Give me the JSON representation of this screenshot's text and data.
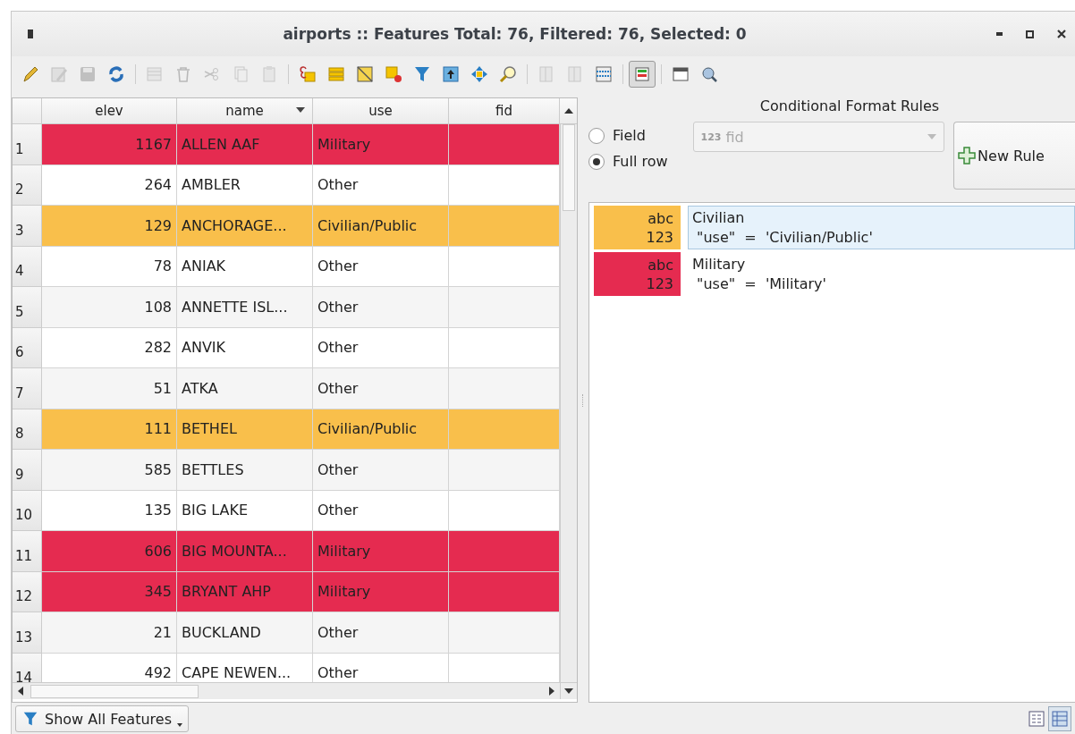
{
  "window": {
    "title": "airports :: Features Total: 76, Filtered: 76, Selected: 0"
  },
  "toolbar": [
    {
      "kind": "pencil",
      "disabled": false,
      "on": false
    },
    {
      "kind": "multi-edit",
      "disabled": true,
      "on": false
    },
    {
      "kind": "save",
      "disabled": true,
      "on": false
    },
    {
      "kind": "refresh",
      "disabled": false,
      "on": false
    },
    {
      "kind": "separator"
    },
    {
      "kind": "add-row",
      "disabled": true,
      "on": false
    },
    {
      "kind": "trash",
      "disabled": true,
      "on": false
    },
    {
      "kind": "scissors",
      "disabled": true,
      "on": false
    },
    {
      "kind": "copy",
      "disabled": true,
      "on": false
    },
    {
      "kind": "paste",
      "disabled": true,
      "on": false
    },
    {
      "kind": "separator"
    },
    {
      "kind": "expression",
      "disabled": false,
      "on": false
    },
    {
      "kind": "select-all",
      "disabled": false,
      "on": false
    },
    {
      "kind": "invert",
      "disabled": false,
      "on": false
    },
    {
      "kind": "deselect",
      "disabled": false,
      "on": false
    },
    {
      "kind": "funnel",
      "disabled": false,
      "on": false
    },
    {
      "kind": "move-top",
      "disabled": false,
      "on": false
    },
    {
      "kind": "pan",
      "disabled": false,
      "on": false
    },
    {
      "kind": "zoom",
      "disabled": false,
      "on": false
    },
    {
      "kind": "separator"
    },
    {
      "kind": "add-column",
      "disabled": true,
      "on": false
    },
    {
      "kind": "delete-column",
      "disabled": true,
      "on": false
    },
    {
      "kind": "calculator",
      "disabled": false,
      "on": false
    },
    {
      "kind": "separator"
    },
    {
      "kind": "format",
      "disabled": false,
      "on": true
    },
    {
      "kind": "separator"
    },
    {
      "kind": "dock",
      "disabled": false,
      "on": false
    },
    {
      "kind": "actions",
      "disabled": false,
      "on": false
    }
  ],
  "table": {
    "columns": [
      {
        "label": "elev",
        "sorted": false
      },
      {
        "label": "name",
        "sorted": true
      },
      {
        "label": "use",
        "sorted": false
      },
      {
        "label": "fid",
        "sorted": false
      }
    ],
    "rows": [
      {
        "number": "1",
        "elev": "1167",
        "name": "ALLEN AAF",
        "use": "Military",
        "color": "#e52b50"
      },
      {
        "number": "2",
        "elev": "264",
        "name": "AMBLER",
        "use": "Other"
      },
      {
        "number": "3",
        "elev": "129",
        "name": "ANCHORAGE...",
        "use": "Civilian/Public",
        "color": "#f9bf4b"
      },
      {
        "number": "4",
        "elev": "78",
        "name": "ANIAK",
        "use": "Other"
      },
      {
        "number": "5",
        "elev": "108",
        "name": "ANNETTE ISL...",
        "use": "Other"
      },
      {
        "number": "6",
        "elev": "282",
        "name": "ANVIK",
        "use": "Other"
      },
      {
        "number": "7",
        "elev": "51",
        "name": "ATKA",
        "use": "Other"
      },
      {
        "number": "8",
        "elev": "111",
        "name": "BETHEL",
        "use": "Civilian/Public",
        "color": "#f9bf4b"
      },
      {
        "number": "9",
        "elev": "585",
        "name": "BETTLES",
        "use": "Other"
      },
      {
        "number": "10",
        "elev": "135",
        "name": "BIG LAKE",
        "use": "Other"
      },
      {
        "number": "11",
        "elev": "606",
        "name": "BIG MOUNTA...",
        "use": "Military",
        "color": "#e52b50"
      },
      {
        "number": "12",
        "elev": "345",
        "name": "BRYANT AHP",
        "use": "Military",
        "color": "#e52b50"
      },
      {
        "number": "13",
        "elev": "21",
        "name": "BUCKLAND",
        "use": "Other"
      },
      {
        "number": "14",
        "elev": "492",
        "name": "CAPE NEWEN...",
        "use": "Other"
      }
    ]
  },
  "conditional_format": {
    "title": "Conditional Format Rules",
    "options": [
      {
        "label": "Field",
        "selected": false
      },
      {
        "label": "Full row",
        "selected": true
      }
    ],
    "field_select": {
      "type_badge": "123",
      "value": "fid",
      "disabled": true
    },
    "new_rule_button": "New Rule",
    "rules": [
      {
        "preview": [
          "abc",
          "123"
        ],
        "name": "Civilian",
        "expression": "\"use\"  =  'Civilian/Public'",
        "color": "#f9bf4b",
        "selected": true
      },
      {
        "preview": [
          "abc",
          "123"
        ],
        "name": "Military",
        "expression": "\"use\"  =  'Military'",
        "color": "#e52b50",
        "selected": false
      }
    ]
  },
  "bottom": {
    "filter_button": "Show All Features",
    "view_buttons": [
      {
        "kind": "form",
        "selected": false
      },
      {
        "kind": "table",
        "selected": true
      }
    ]
  }
}
